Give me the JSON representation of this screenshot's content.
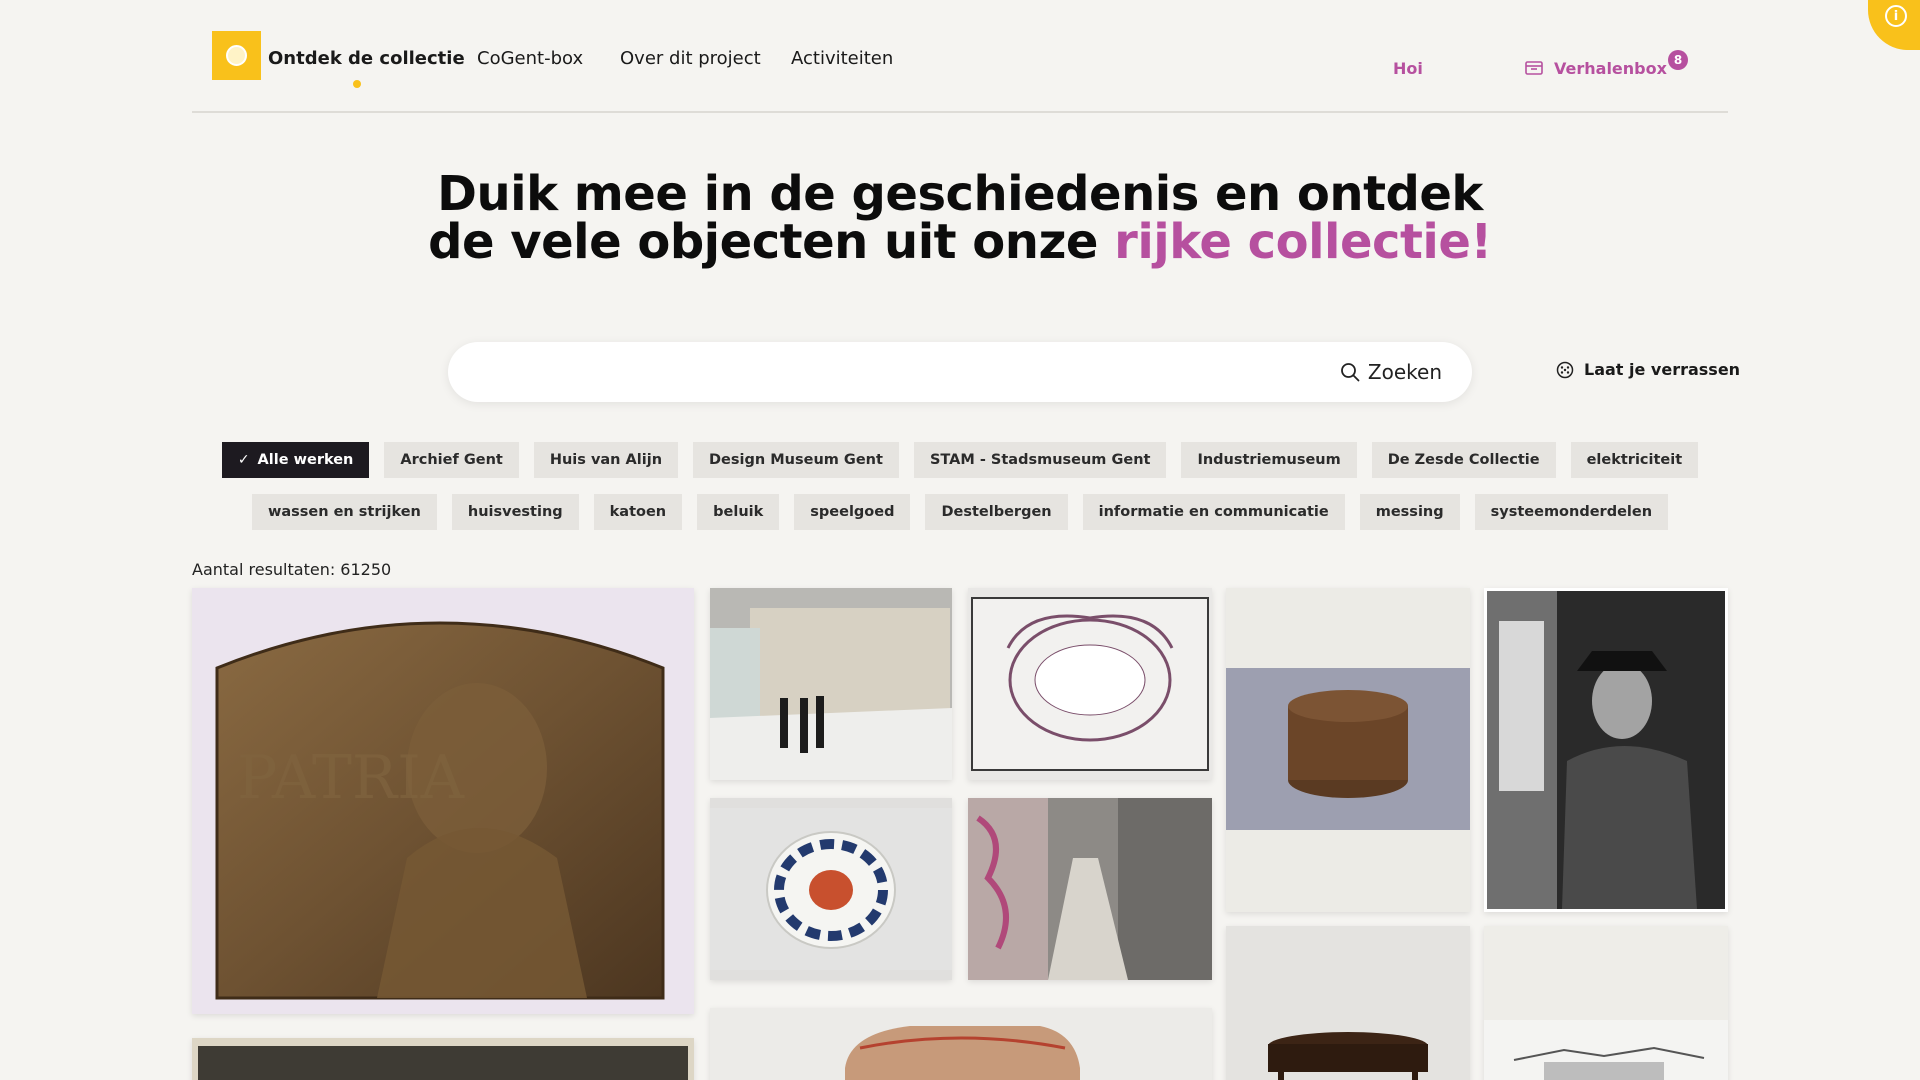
{
  "nav": {
    "brand": "Ontdek de collectie",
    "links": [
      "CoGent-box",
      "Over dit project",
      "Activiteiten"
    ],
    "greeting": "Hoi",
    "storybox_label": "Verhalenbox",
    "storybox_count": "8",
    "info_icon": "info-icon"
  },
  "hero": {
    "line1": "Duik mee in de geschiedenis en ontdek",
    "line2_plain": "de vele objecten uit onze ",
    "line2_accent": "rijke collectie!"
  },
  "search": {
    "placeholder": "",
    "button_label": "Zoeken",
    "surprise_label": "Laat je verrassen"
  },
  "filters": {
    "row1": [
      "Alle werken",
      "Archief Gent",
      "Huis van Alijn",
      "Design Museum Gent",
      "STAM - Stadsmuseum Gent",
      "Industriemuseum",
      "De Zesde Collectie",
      "elektriciteit"
    ],
    "row2": [
      "wassen en strijken",
      "huisvesting",
      "katoen",
      "beluik",
      "speelgoed",
      "Destelbergen",
      "informatie en communicatie",
      "messing",
      "systeemonderdelen"
    ],
    "selected": "Alle werken"
  },
  "results": {
    "count_label": "Aantal resultaten: 61250"
  },
  "colors": {
    "accent": "#b6509f",
    "brand_yellow": "#f9c11b",
    "background": "#f5f4f1"
  }
}
